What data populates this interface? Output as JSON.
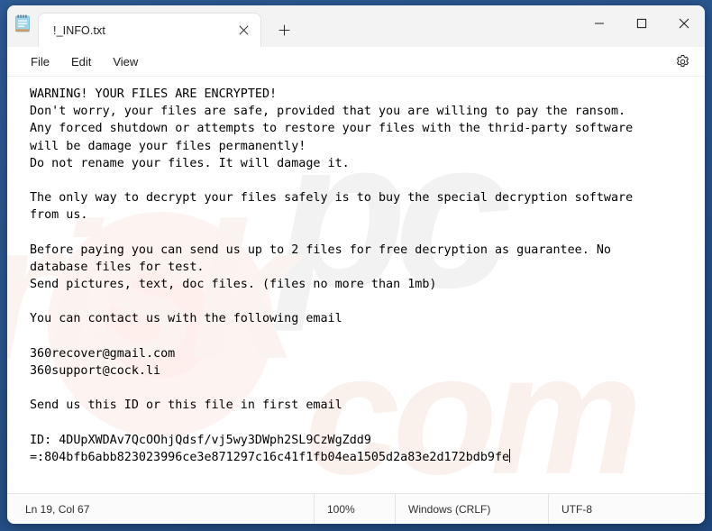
{
  "window": {
    "app_icon": "notepad-icon",
    "tab_title": "!_INFO.txt",
    "close_tab_icon": "close-icon",
    "new_tab_icon": "plus-icon",
    "minimize_icon": "minimize-icon",
    "maximize_icon": "maximize-icon",
    "close_icon": "close-icon"
  },
  "menubar": {
    "items": [
      {
        "label": "File"
      },
      {
        "label": "Edit"
      },
      {
        "label": "View"
      }
    ],
    "settings_icon": "gear-icon"
  },
  "watermark": {
    "word1": "pc",
    "word2": "risk",
    "word3": "com"
  },
  "document": {
    "lines": [
      "WARNING! YOUR FILES ARE ENCRYPTED!",
      "Don't worry, your files are safe, provided that you are willing to pay the ransom.",
      "Any forced shutdown or attempts to restore your files with the thrid-party software",
      "will be damage your files permanently!",
      "Do not rename your files. It will damage it.",
      "",
      "The only way to decrypt your files safely is to buy the special decryption software",
      "from us.",
      "",
      "Before paying you can send us up to 2 files for free decryption as guarantee. No",
      "database files for test.",
      "Send pictures, text, doc files. (files no more than 1mb)",
      "",
      "You can contact us with the following email",
      "",
      "360recover@gmail.com",
      "360support@cock.li",
      "",
      "Send us this ID or this file in first email",
      "",
      "ID: 4DUpXWDAv7QcOOhjQdsf/vj5wy3DWph2SL9CzWgZdd9",
      "=:804bfb6abb823023996ce3e871297c16c41f1fb04ea1505d2a83e2d172bdb9fe"
    ]
  },
  "statusbar": {
    "line_col": "Ln 19, Col 67",
    "zoom": "100%",
    "line_ending": "Windows (CRLF)",
    "encoding": "UTF-8"
  },
  "colors": {
    "desktop": "#2d5a92",
    "window": "#f3f3f3",
    "editor": "#ffffff",
    "text": "#000000"
  }
}
